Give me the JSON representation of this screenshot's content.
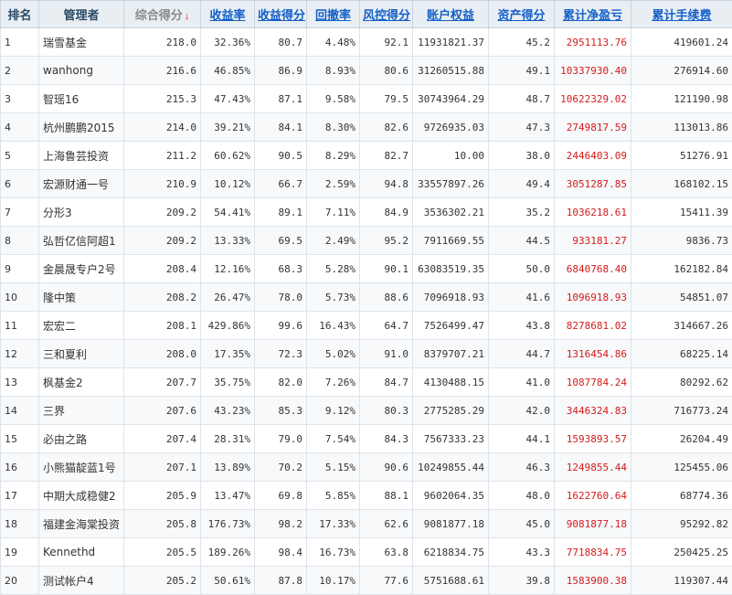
{
  "table": {
    "headers": {
      "rank": "排名",
      "manager": "管理者",
      "score": "综合得分",
      "sort_arrow": "↓",
      "return_rate": "收益率",
      "return_score": "收益得分",
      "drawdown": "回撤率",
      "risk_score": "风控得分",
      "account_equity": "账户权益",
      "asset_score": "资产得分",
      "cum_pnl": "累计净盈亏",
      "cum_fee": "累计手续费"
    },
    "rows": [
      {
        "rank": "1",
        "manager": "瑞雪基金",
        "score": "218.0",
        "return_rate": "32.36%",
        "return_score": "80.7",
        "drawdown": "4.48%",
        "risk_score": "92.1",
        "account_equity": "11931821.37",
        "asset_score": "45.2",
        "cum_pnl": "2951113.76",
        "cum_fee": "419601.24"
      },
      {
        "rank": "2",
        "manager": "wanhong",
        "score": "216.6",
        "return_rate": "46.85%",
        "return_score": "86.9",
        "drawdown": "8.93%",
        "risk_score": "80.6",
        "account_equity": "31260515.88",
        "asset_score": "49.1",
        "cum_pnl": "10337930.40",
        "cum_fee": "276914.60"
      },
      {
        "rank": "3",
        "manager": "智瑶16",
        "score": "215.3",
        "return_rate": "47.43%",
        "return_score": "87.1",
        "drawdown": "9.58%",
        "risk_score": "79.5",
        "account_equity": "30743964.29",
        "asset_score": "48.7",
        "cum_pnl": "10622329.02",
        "cum_fee": "121190.98"
      },
      {
        "rank": "4",
        "manager": "杭州鹏鹏2015",
        "score": "214.0",
        "return_rate": "39.21%",
        "return_score": "84.1",
        "drawdown": "8.30%",
        "risk_score": "82.6",
        "account_equity": "9726935.03",
        "asset_score": "47.3",
        "cum_pnl": "2749817.59",
        "cum_fee": "113013.86"
      },
      {
        "rank": "5",
        "manager": "上海鲁芸投资",
        "score": "211.2",
        "return_rate": "60.62%",
        "return_score": "90.5",
        "drawdown": "8.29%",
        "risk_score": "82.7",
        "account_equity": "10.00",
        "asset_score": "38.0",
        "cum_pnl": "2446403.09",
        "cum_fee": "51276.91"
      },
      {
        "rank": "6",
        "manager": "宏源财通一号",
        "score": "210.9",
        "return_rate": "10.12%",
        "return_score": "66.7",
        "drawdown": "2.59%",
        "risk_score": "94.8",
        "account_equity": "33557897.26",
        "asset_score": "49.4",
        "cum_pnl": "3051287.85",
        "cum_fee": "168102.15"
      },
      {
        "rank": "7",
        "manager": "分形3",
        "score": "209.2",
        "return_rate": "54.41%",
        "return_score": "89.1",
        "drawdown": "7.11%",
        "risk_score": "84.9",
        "account_equity": "3536302.21",
        "asset_score": "35.2",
        "cum_pnl": "1036218.61",
        "cum_fee": "15411.39"
      },
      {
        "rank": "8",
        "manager": "弘哲亿信阿超1",
        "score": "209.2",
        "return_rate": "13.33%",
        "return_score": "69.5",
        "drawdown": "2.49%",
        "risk_score": "95.2",
        "account_equity": "7911669.55",
        "asset_score": "44.5",
        "cum_pnl": "933181.27",
        "cum_fee": "9836.73"
      },
      {
        "rank": "9",
        "manager": "金晨晟专户2号",
        "score": "208.4",
        "return_rate": "12.16%",
        "return_score": "68.3",
        "drawdown": "5.28%",
        "risk_score": "90.1",
        "account_equity": "63083519.35",
        "asset_score": "50.0",
        "cum_pnl": "6840768.40",
        "cum_fee": "162182.84"
      },
      {
        "rank": "10",
        "manager": "隆中策",
        "score": "208.2",
        "return_rate": "26.47%",
        "return_score": "78.0",
        "drawdown": "5.73%",
        "risk_score": "88.6",
        "account_equity": "7096918.93",
        "asset_score": "41.6",
        "cum_pnl": "1096918.93",
        "cum_fee": "54851.07"
      },
      {
        "rank": "11",
        "manager": "宏宏二",
        "score": "208.1",
        "return_rate": "429.86%",
        "return_score": "99.6",
        "drawdown": "16.43%",
        "risk_score": "64.7",
        "account_equity": "7526499.47",
        "asset_score": "43.8",
        "cum_pnl": "8278681.02",
        "cum_fee": "314667.26"
      },
      {
        "rank": "12",
        "manager": "三和夏利",
        "score": "208.0",
        "return_rate": "17.35%",
        "return_score": "72.3",
        "drawdown": "5.02%",
        "risk_score": "91.0",
        "account_equity": "8379707.21",
        "asset_score": "44.7",
        "cum_pnl": "1316454.86",
        "cum_fee": "68225.14"
      },
      {
        "rank": "13",
        "manager": "枫基金2",
        "score": "207.7",
        "return_rate": "35.75%",
        "return_score": "82.0",
        "drawdown": "7.26%",
        "risk_score": "84.7",
        "account_equity": "4130488.15",
        "asset_score": "41.0",
        "cum_pnl": "1087784.24",
        "cum_fee": "80292.62"
      },
      {
        "rank": "14",
        "manager": "三界",
        "score": "207.6",
        "return_rate": "43.23%",
        "return_score": "85.3",
        "drawdown": "9.12%",
        "risk_score": "80.3",
        "account_equity": "2775285.29",
        "asset_score": "42.0",
        "cum_pnl": "3446324.83",
        "cum_fee": "716773.24"
      },
      {
        "rank": "15",
        "manager": "必由之路",
        "score": "207.4",
        "return_rate": "28.31%",
        "return_score": "79.0",
        "drawdown": "7.54%",
        "risk_score": "84.3",
        "account_equity": "7567333.23",
        "asset_score": "44.1",
        "cum_pnl": "1593893.57",
        "cum_fee": "26204.49"
      },
      {
        "rank": "16",
        "manager": "小熊猫靛蓝1号",
        "score": "207.1",
        "return_rate": "13.89%",
        "return_score": "70.2",
        "drawdown": "5.15%",
        "risk_score": "90.6",
        "account_equity": "10249855.44",
        "asset_score": "46.3",
        "cum_pnl": "1249855.44",
        "cum_fee": "125455.06"
      },
      {
        "rank": "17",
        "manager": "中期大成稳健2",
        "score": "205.9",
        "return_rate": "13.47%",
        "return_score": "69.8",
        "drawdown": "5.85%",
        "risk_score": "88.1",
        "account_equity": "9602064.35",
        "asset_score": "48.0",
        "cum_pnl": "1622760.64",
        "cum_fee": "68774.36"
      },
      {
        "rank": "18",
        "manager": "福建金海棠投资",
        "score": "205.8",
        "return_rate": "176.73%",
        "return_score": "98.2",
        "drawdown": "17.33%",
        "risk_score": "62.6",
        "account_equity": "9081877.18",
        "asset_score": "45.0",
        "cum_pnl": "9081877.18",
        "cum_fee": "95292.82"
      },
      {
        "rank": "19",
        "manager": "Kennethd",
        "score": "205.5",
        "return_rate": "189.26%",
        "return_score": "98.4",
        "drawdown": "16.73%",
        "risk_score": "63.8",
        "account_equity": "6218834.75",
        "asset_score": "43.3",
        "cum_pnl": "7718834.75",
        "cum_fee": "250425.25"
      },
      {
        "rank": "20",
        "manager": "测试帐户4",
        "score": "205.2",
        "return_rate": "50.61%",
        "return_score": "87.8",
        "drawdown": "10.17%",
        "risk_score": "77.6",
        "account_equity": "5751688.61",
        "asset_score": "39.8",
        "cum_pnl": "1583900.38",
        "cum_fee": "119307.44"
      }
    ]
  },
  "colors": {
    "link_header": "#1560c9",
    "sorted_header": "#8a8a8a",
    "sort_arrow": "#d42020",
    "pnl_value": "#d41b1b",
    "header_bg": "#e9eef3"
  }
}
